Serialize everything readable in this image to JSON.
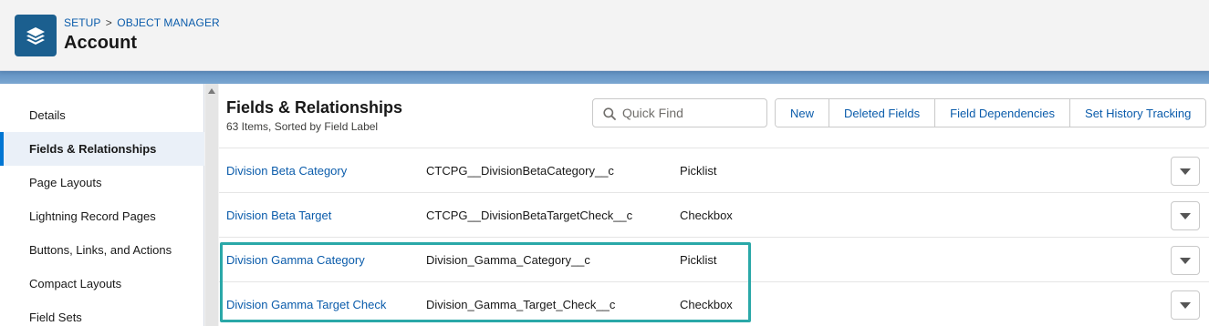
{
  "header": {
    "breadcrumb_setup": "SETUP",
    "breadcrumb_sep": ">",
    "breadcrumb_object_manager": "OBJECT MANAGER",
    "title": "Account",
    "icon": "layers-icon"
  },
  "sidebar": {
    "items": [
      {
        "label": "Details",
        "active": false
      },
      {
        "label": "Fields & Relationships",
        "active": true
      },
      {
        "label": "Page Layouts",
        "active": false
      },
      {
        "label": "Lightning Record Pages",
        "active": false
      },
      {
        "label": "Buttons, Links, and Actions",
        "active": false
      },
      {
        "label": "Compact Layouts",
        "active": false
      },
      {
        "label": "Field Sets",
        "active": false
      }
    ]
  },
  "main": {
    "title": "Fields & Relationships",
    "subtitle": "63 Items, Sorted by Field Label",
    "search_placeholder": "Quick Find",
    "search_value": "",
    "buttons": [
      "New",
      "Deleted Fields",
      "Field Dependencies",
      "Set History Tracking"
    ],
    "rows": [
      {
        "label": "Division Beta Category",
        "api": "CTCPG__DivisionBetaCategory__c",
        "type": "Picklist"
      },
      {
        "label": "Division Beta Target",
        "api": "CTCPG__DivisionBetaTargetCheck__c",
        "type": "Checkbox"
      },
      {
        "label": "Division Gamma Category",
        "api": "Division_Gamma_Category__c",
        "type": "Picklist"
      },
      {
        "label": "Division Gamma Target Check",
        "api": "Division_Gamma_Target_Check__c",
        "type": "Checkbox"
      }
    ]
  },
  "colors": {
    "brand_blue": "#0b5cab",
    "icon_bg": "#1b5f8f",
    "highlight": "#2aa8a8",
    "active_item_bg": "#eaf0f8"
  }
}
